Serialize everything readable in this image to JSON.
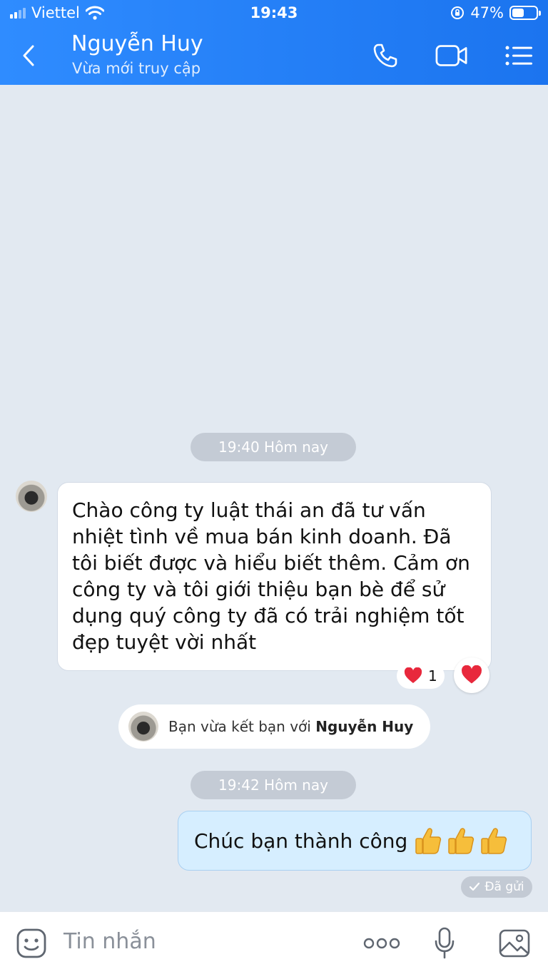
{
  "status_bar": {
    "carrier": "Viettel",
    "time": "19:43",
    "battery": "47%",
    "battery_level": 0.47
  },
  "header": {
    "contact_name": "Nguyễn Huy",
    "contact_status": "Vừa mới truy cập",
    "icons": [
      "back-chevron-icon",
      "phone-icon",
      "video-call-icon",
      "menu-list-icon"
    ],
    "accent_color": "#1b74ef"
  },
  "messages": {
    "time_divider_1": "19:40 Hôm nay",
    "incoming_text": "Chào công ty  luật thái an đã tư vấn nhiệt tình về mua bán kinh doanh. Đã tôi biết được và hiểu biết thêm. Cảm ơn công ty và tôi giới thiệu bạn bè để sử dụng quý công ty đã có trải nghiệm tốt đẹp tuyệt vời nhất",
    "reaction_count": "1",
    "friend_note_prefix": "Bạn vừa kết bạn với",
    "friend_note_name": "Nguyễn Huy",
    "time_divider_2": "19:42 Hôm nay",
    "outgoing_text": "Chúc bạn thành công",
    "sent_status": "Đã gửi"
  },
  "input_bar": {
    "placeholder": "Tin nhắn",
    "icons": [
      "sticker-icon",
      "more-icon",
      "microphone-icon",
      "image-icon"
    ]
  }
}
